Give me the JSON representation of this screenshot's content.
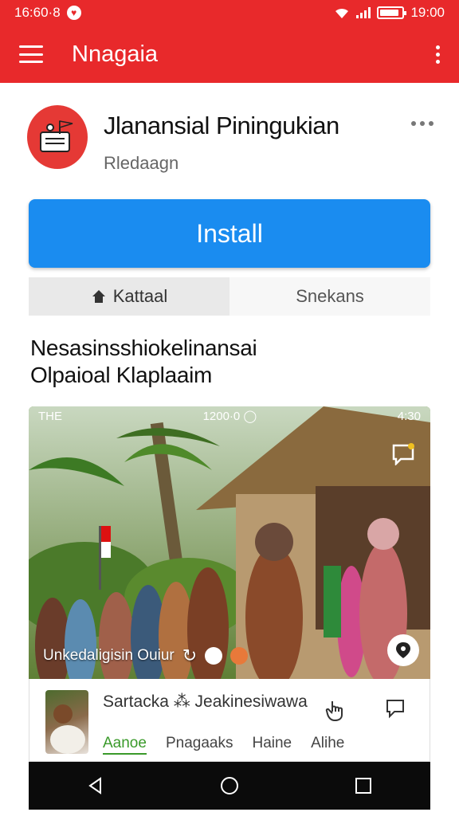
{
  "status_bar": {
    "left_time": "16:60·8",
    "right_time": "19:00",
    "battery_level": 0.85
  },
  "app_bar": {
    "title": "Nnagaia"
  },
  "app": {
    "name": "Jlanansial Piningukian",
    "developer": "Rledaagn",
    "install_label": "Install"
  },
  "tabs": [
    {
      "label": "Kattaal",
      "icon": "home-icon",
      "active": true
    },
    {
      "label": "Snekans",
      "active": false
    }
  ],
  "description": {
    "line1": "Nesasinsshiokelinansai",
    "line2": "Olpaioal Klaplaaim"
  },
  "screenshot": {
    "status_left": "THE",
    "status_center": "1200·0 ◯",
    "status_right": "4:30",
    "caption": "Unkedaligisin Ouiur"
  },
  "card": {
    "title": "Sartacka ⁂ Jeakinesiwawa",
    "tabs": [
      "Aanoe",
      "Pnagaaks",
      "Haine",
      "Alihe"
    ]
  },
  "colors": {
    "brand": "#e8292b",
    "install": "#1a8cf0",
    "active_tab_text": "#3a9a2a"
  }
}
